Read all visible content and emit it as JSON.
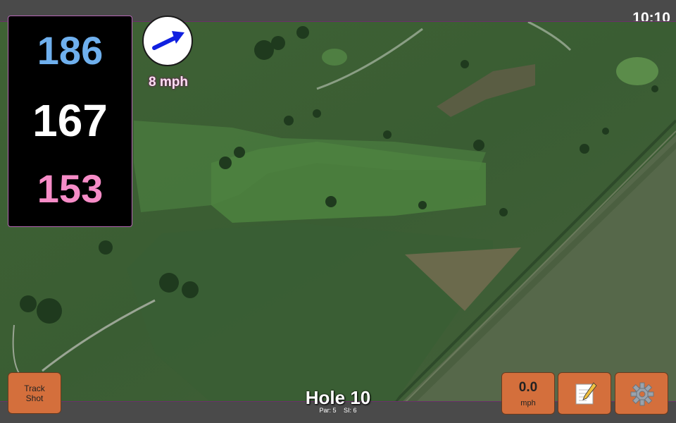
{
  "status": {
    "clock": "10:10"
  },
  "distances": {
    "back": "186",
    "middle": "167",
    "front": "153"
  },
  "wind": {
    "speed_label": "8 mph"
  },
  "buttons": {
    "track_shot_line1": "Track",
    "track_shot_line2": "Shot",
    "speed_value": "0.0",
    "speed_unit": "mph"
  },
  "hole": {
    "title": "Hole 10",
    "par": "Par: 5",
    "si": "SI: 6"
  },
  "colors": {
    "back": "#6fb0ee",
    "middle": "#ffffff",
    "front": "#f68cc7",
    "button": "#d46f3c",
    "wind_arrow": "#1020e0"
  },
  "icons": {
    "wind": "arrow-icon",
    "note": "notepad-icon",
    "settings": "gear-icon"
  }
}
